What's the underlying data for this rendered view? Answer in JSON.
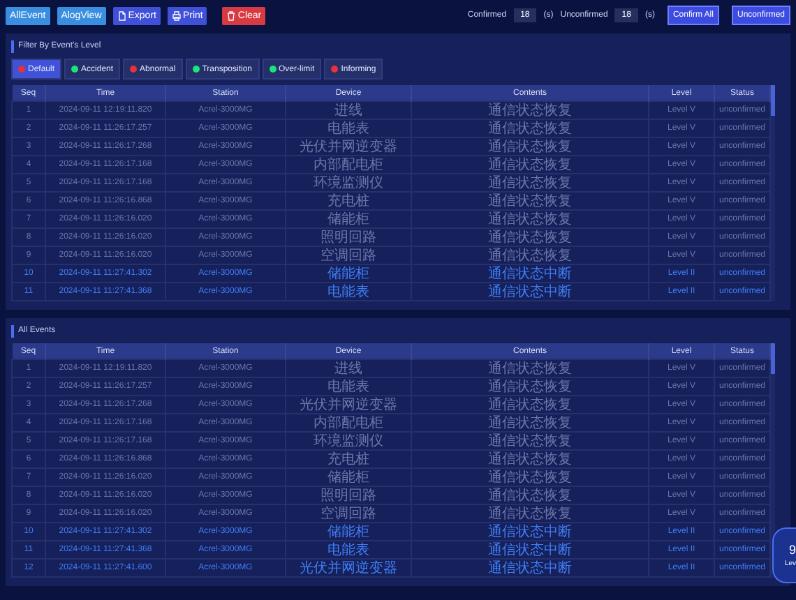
{
  "toolbar": {
    "buttons": [
      {
        "label": "AllEvent",
        "kind": "plain"
      },
      {
        "label": "AlogView",
        "kind": "plain"
      },
      {
        "label": "Export",
        "kind": "export"
      },
      {
        "label": "Print",
        "kind": "print"
      },
      {
        "label": "Clear",
        "kind": "clear"
      }
    ],
    "confirmed_label": "Confirmed",
    "confirmed_value": "18",
    "confirmed_unit": "(s)",
    "unconfirmed_label": "Unconfirmed",
    "unconfirmed_value": "18",
    "unconfirmed_unit": "(s)",
    "actions": [
      "Confirm All",
      "Unconfirmed"
    ]
  },
  "filter_panel": {
    "title": "Filter By Event's Level",
    "filters": [
      {
        "label": "Default",
        "color": "#e8313a",
        "selected": true
      },
      {
        "label": "Accident",
        "color": "#19e57a",
        "selected": false
      },
      {
        "label": "Abnormal",
        "color": "#e8313a",
        "selected": false
      },
      {
        "label": "Transposition",
        "color": "#19e57a",
        "selected": false
      },
      {
        "label": "Over-limit",
        "color": "#19e57a",
        "selected": false
      },
      {
        "label": "Informing",
        "color": "#e8313a",
        "selected": false
      }
    ],
    "table": {
      "columns": [
        "Seq",
        "Time",
        "Station",
        "Device",
        "Contents",
        "Level",
        "Status"
      ],
      "rows": [
        {
          "cells": [
            "1",
            "2024-09-11 12:19:11.820",
            "Acrel-3000MG",
            "进线",
            "通信状态恢复",
            "Level V",
            "unconfirmed"
          ],
          "highlighted": false
        },
        {
          "cells": [
            "2",
            "2024-09-11 11:26:17.257",
            "Acrel-3000MG",
            "电能表",
            "通信状态恢复",
            "Level V",
            "unconfirmed"
          ],
          "highlighted": false
        },
        {
          "cells": [
            "3",
            "2024-09-11 11:26:17.268",
            "Acrel-3000MG",
            "光伏并网逆变器",
            "通信状态恢复",
            "Level V",
            "unconfirmed"
          ],
          "highlighted": false
        },
        {
          "cells": [
            "4",
            "2024-09-11 11:26:17.168",
            "Acrel-3000MG",
            "内部配电柜",
            "通信状态恢复",
            "Level V",
            "unconfirmed"
          ],
          "highlighted": false
        },
        {
          "cells": [
            "5",
            "2024-09-11 11:26:17.168",
            "Acrel-3000MG",
            "环境监测仪",
            "通信状态恢复",
            "Level V",
            "unconfirmed"
          ],
          "highlighted": false
        },
        {
          "cells": [
            "6",
            "2024-09-11 11:26:16.868",
            "Acrel-3000MG",
            "充电桩",
            "通信状态恢复",
            "Level V",
            "unconfirmed"
          ],
          "highlighted": false
        },
        {
          "cells": [
            "7",
            "2024-09-11 11:26:16.020",
            "Acrel-3000MG",
            "储能柜",
            "通信状态恢复",
            "Level V",
            "unconfirmed"
          ],
          "highlighted": false
        },
        {
          "cells": [
            "8",
            "2024-09-11 11:26:16.020",
            "Acrel-3000MG",
            "照明回路",
            "通信状态恢复",
            "Level V",
            "unconfirmed"
          ],
          "highlighted": false
        },
        {
          "cells": [
            "9",
            "2024-09-11 11:26:16.020",
            "Acrel-3000MG",
            "空调回路",
            "通信状态恢复",
            "Level V",
            "unconfirmed"
          ],
          "highlighted": false
        },
        {
          "cells": [
            "10",
            "2024-09-11 11:27:41.302",
            "Acrel-3000MG",
            "储能柜",
            "通信状态中断",
            "Level II",
            "unconfirmed"
          ],
          "highlighted": true
        },
        {
          "cells": [
            "11",
            "2024-09-11 11:27:41.368",
            "Acrel-3000MG",
            "电能表",
            "通信状态中断",
            "Level II",
            "unconfirmed"
          ],
          "highlighted": true
        }
      ]
    }
  },
  "events_panel": {
    "title": "All Events",
    "table": {
      "columns": [
        "Seq",
        "Time",
        "Station",
        "Device",
        "Contents",
        "Level",
        "Status"
      ],
      "rows": [
        {
          "cells": [
            "1",
            "2024-09-11 12:19:11.820",
            "Acrel-3000MG",
            "进线",
            "通信状态恢复",
            "Level V",
            "unconfirmed"
          ],
          "highlighted": false
        },
        {
          "cells": [
            "2",
            "2024-09-11 11:26:17.257",
            "Acrel-3000MG",
            "电能表",
            "通信状态恢复",
            "Level V",
            "unconfirmed"
          ],
          "highlighted": false
        },
        {
          "cells": [
            "3",
            "2024-09-11 11:26:17.268",
            "Acrel-3000MG",
            "光伏并网逆变器",
            "通信状态恢复",
            "Level V",
            "unconfirmed"
          ],
          "highlighted": false
        },
        {
          "cells": [
            "4",
            "2024-09-11 11:26:17.168",
            "Acrel-3000MG",
            "内部配电柜",
            "通信状态恢复",
            "Level V",
            "unconfirmed"
          ],
          "highlighted": false
        },
        {
          "cells": [
            "5",
            "2024-09-11 11:26:17.168",
            "Acrel-3000MG",
            "环境监测仪",
            "通信状态恢复",
            "Level V",
            "unconfirmed"
          ],
          "highlighted": false
        },
        {
          "cells": [
            "6",
            "2024-09-11 11:26:16.868",
            "Acrel-3000MG",
            "充电桩",
            "通信状态恢复",
            "Level V",
            "unconfirmed"
          ],
          "highlighted": false
        },
        {
          "cells": [
            "7",
            "2024-09-11 11:26:16.020",
            "Acrel-3000MG",
            "储能柜",
            "通信状态恢复",
            "Level V",
            "unconfirmed"
          ],
          "highlighted": false
        },
        {
          "cells": [
            "8",
            "2024-09-11 11:26:16.020",
            "Acrel-3000MG",
            "照明回路",
            "通信状态恢复",
            "Level V",
            "unconfirmed"
          ],
          "highlighted": false
        },
        {
          "cells": [
            "9",
            "2024-09-11 11:26:16.020",
            "Acrel-3000MG",
            "空调回路",
            "通信状态恢复",
            "Level V",
            "unconfirmed"
          ],
          "highlighted": false
        },
        {
          "cells": [
            "10",
            "2024-09-11 11:27:41.302",
            "Acrel-3000MG",
            "储能柜",
            "通信状态中断",
            "Level II",
            "unconfirmed"
          ],
          "highlighted": true
        },
        {
          "cells": [
            "11",
            "2024-09-11 11:27:41.368",
            "Acrel-3000MG",
            "电能表",
            "通信状态中断",
            "Level II",
            "unconfirmed"
          ],
          "highlighted": true
        },
        {
          "cells": [
            "12",
            "2024-09-11 11:27:41.600",
            "Acrel-3000MG",
            "光伏并网逆变器",
            "通信状态中断",
            "Level II",
            "unconfirmed"
          ],
          "highlighted": true
        }
      ]
    }
  },
  "level_badge": {
    "count": "9",
    "label": "Lev"
  }
}
